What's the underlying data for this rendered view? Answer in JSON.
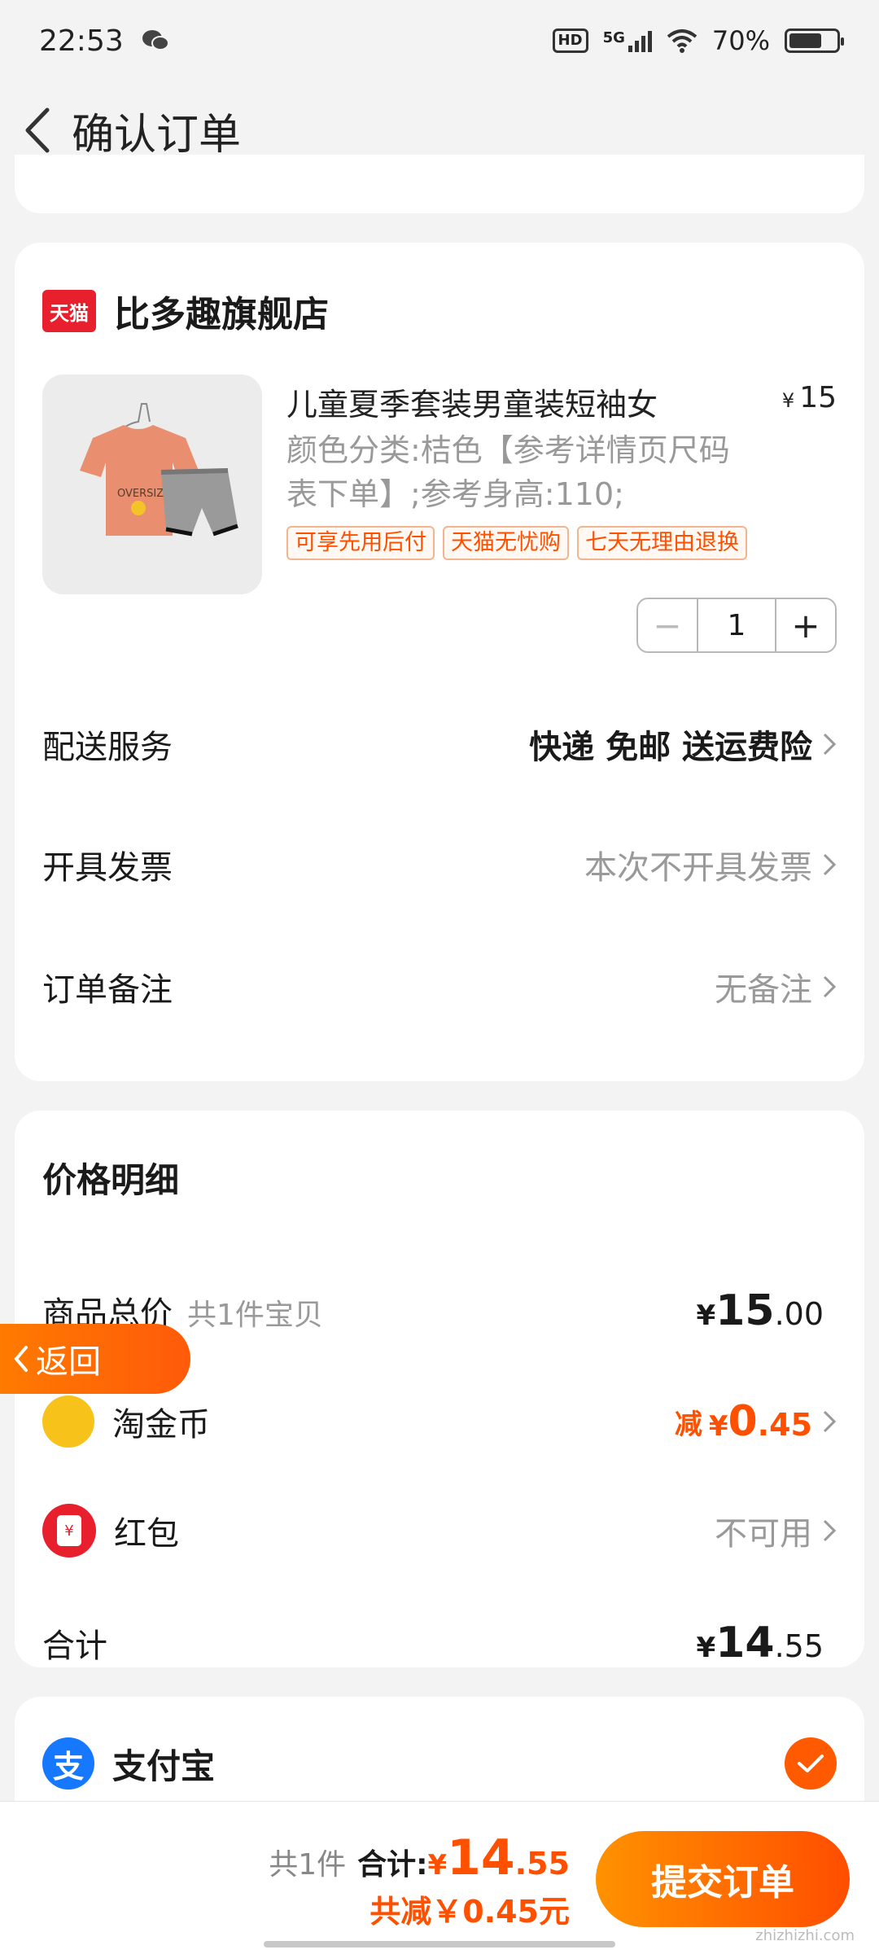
{
  "status_bar": {
    "time": "22:53",
    "hd": "HD",
    "network": "5G",
    "battery": "70%"
  },
  "nav": {
    "title": "确认订单"
  },
  "store": {
    "badge": "天猫",
    "name": "比多趣旗舰店",
    "product": {
      "title": "儿童夏季套装男童装短袖女",
      "currency": "¥",
      "price": "15",
      "spec": "颜色分类:桔色【参考详情页尺码表下单】;参考身高:110;",
      "tags": [
        "可享先用后付",
        "天猫无忧购",
        "七天无理由退换"
      ],
      "quantity": "1",
      "minus": "−",
      "plus": "+",
      "image_text": "OVERSIZE"
    },
    "rows": {
      "delivery": {
        "label": "配送服务",
        "value": "快递 免邮 送运费险"
      },
      "invoice": {
        "label": "开具发票",
        "value": "本次不开具发票"
      },
      "note": {
        "label": "订单备注",
        "value": "无备注"
      }
    }
  },
  "price_detail": {
    "title": "价格明细",
    "goods_total": {
      "label": "商品总价",
      "sub": "共1件宝贝",
      "currency": "¥",
      "int": "15",
      "dec": ".00"
    },
    "coin": {
      "label": "淘金币",
      "prefix": "减",
      "currency": "¥",
      "int": "0",
      "dec": ".45"
    },
    "red_packet": {
      "label": "红包",
      "value": "不可用",
      "envelope": "¥"
    },
    "total": {
      "label": "合计",
      "currency": "¥",
      "int": "14",
      "dec": ".55"
    }
  },
  "payment": {
    "name": "支付宝",
    "logo": "支",
    "selected": true
  },
  "float_back": {
    "label": "返回"
  },
  "bottom_bar": {
    "count": "共1件",
    "total_label": "合计:",
    "currency": "¥",
    "total_int": "14",
    "total_dec": ".55",
    "saving": "共减￥0.45元",
    "submit_label": "提交订单",
    "watermark": "zhizhizhi.com"
  },
  "colors": {
    "accent": "#ff5000",
    "tmall_red": "#e8202d",
    "alipay_blue": "#1677ff"
  }
}
